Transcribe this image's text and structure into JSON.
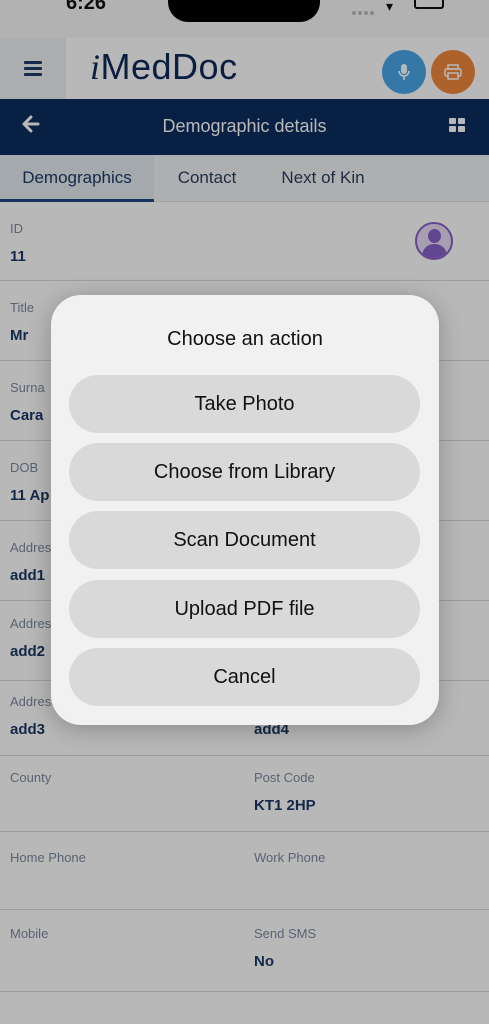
{
  "status": {
    "time": "6:26"
  },
  "app": {
    "logo": "MedDoc",
    "logo_prefix": "i"
  },
  "header": {
    "title": "Demographic details"
  },
  "tabs": [
    "Demographics",
    "Contact",
    "Next of Kin"
  ],
  "fields": {
    "id": {
      "label": "ID",
      "value": "11"
    },
    "title": {
      "label": "Title",
      "value": "Mr"
    },
    "surname": {
      "label": "Surna",
      "value": "Cara"
    },
    "dob": {
      "label": "DOB",
      "value": "11 Ap"
    },
    "address1": {
      "label": "Addres",
      "value": "add1"
    },
    "address2": {
      "label": "Addres",
      "value": "add2"
    },
    "address3": {
      "label": "Addres",
      "value": "add3"
    },
    "address4": {
      "label": "",
      "value": "add4"
    },
    "county": {
      "label": "County",
      "value": ""
    },
    "postcode": {
      "label": "Post Code",
      "value": "KT1 2HP"
    },
    "home_phone": {
      "label": "Home Phone",
      "value": ""
    },
    "work_phone": {
      "label": "Work Phone",
      "value": ""
    },
    "mobile": {
      "label": "Mobile",
      "value": ""
    },
    "send_sms": {
      "label": "Send SMS",
      "value": "No"
    }
  },
  "action_sheet": {
    "title": "Choose an action",
    "actions": [
      "Take Photo",
      "Choose from Library",
      "Scan Document",
      "Upload PDF file",
      "Cancel"
    ]
  },
  "colors": {
    "navy": "#0c2d5f",
    "mic": "#4aa5e6",
    "print": "#f0883e",
    "avatar": "#8a62c8"
  },
  "icons": [
    "hamburger-menu-icon",
    "microphone-icon",
    "printer-icon",
    "back-arrow-icon",
    "grid-icon",
    "avatar-icon",
    "wifi-icon",
    "battery-icon"
  ]
}
